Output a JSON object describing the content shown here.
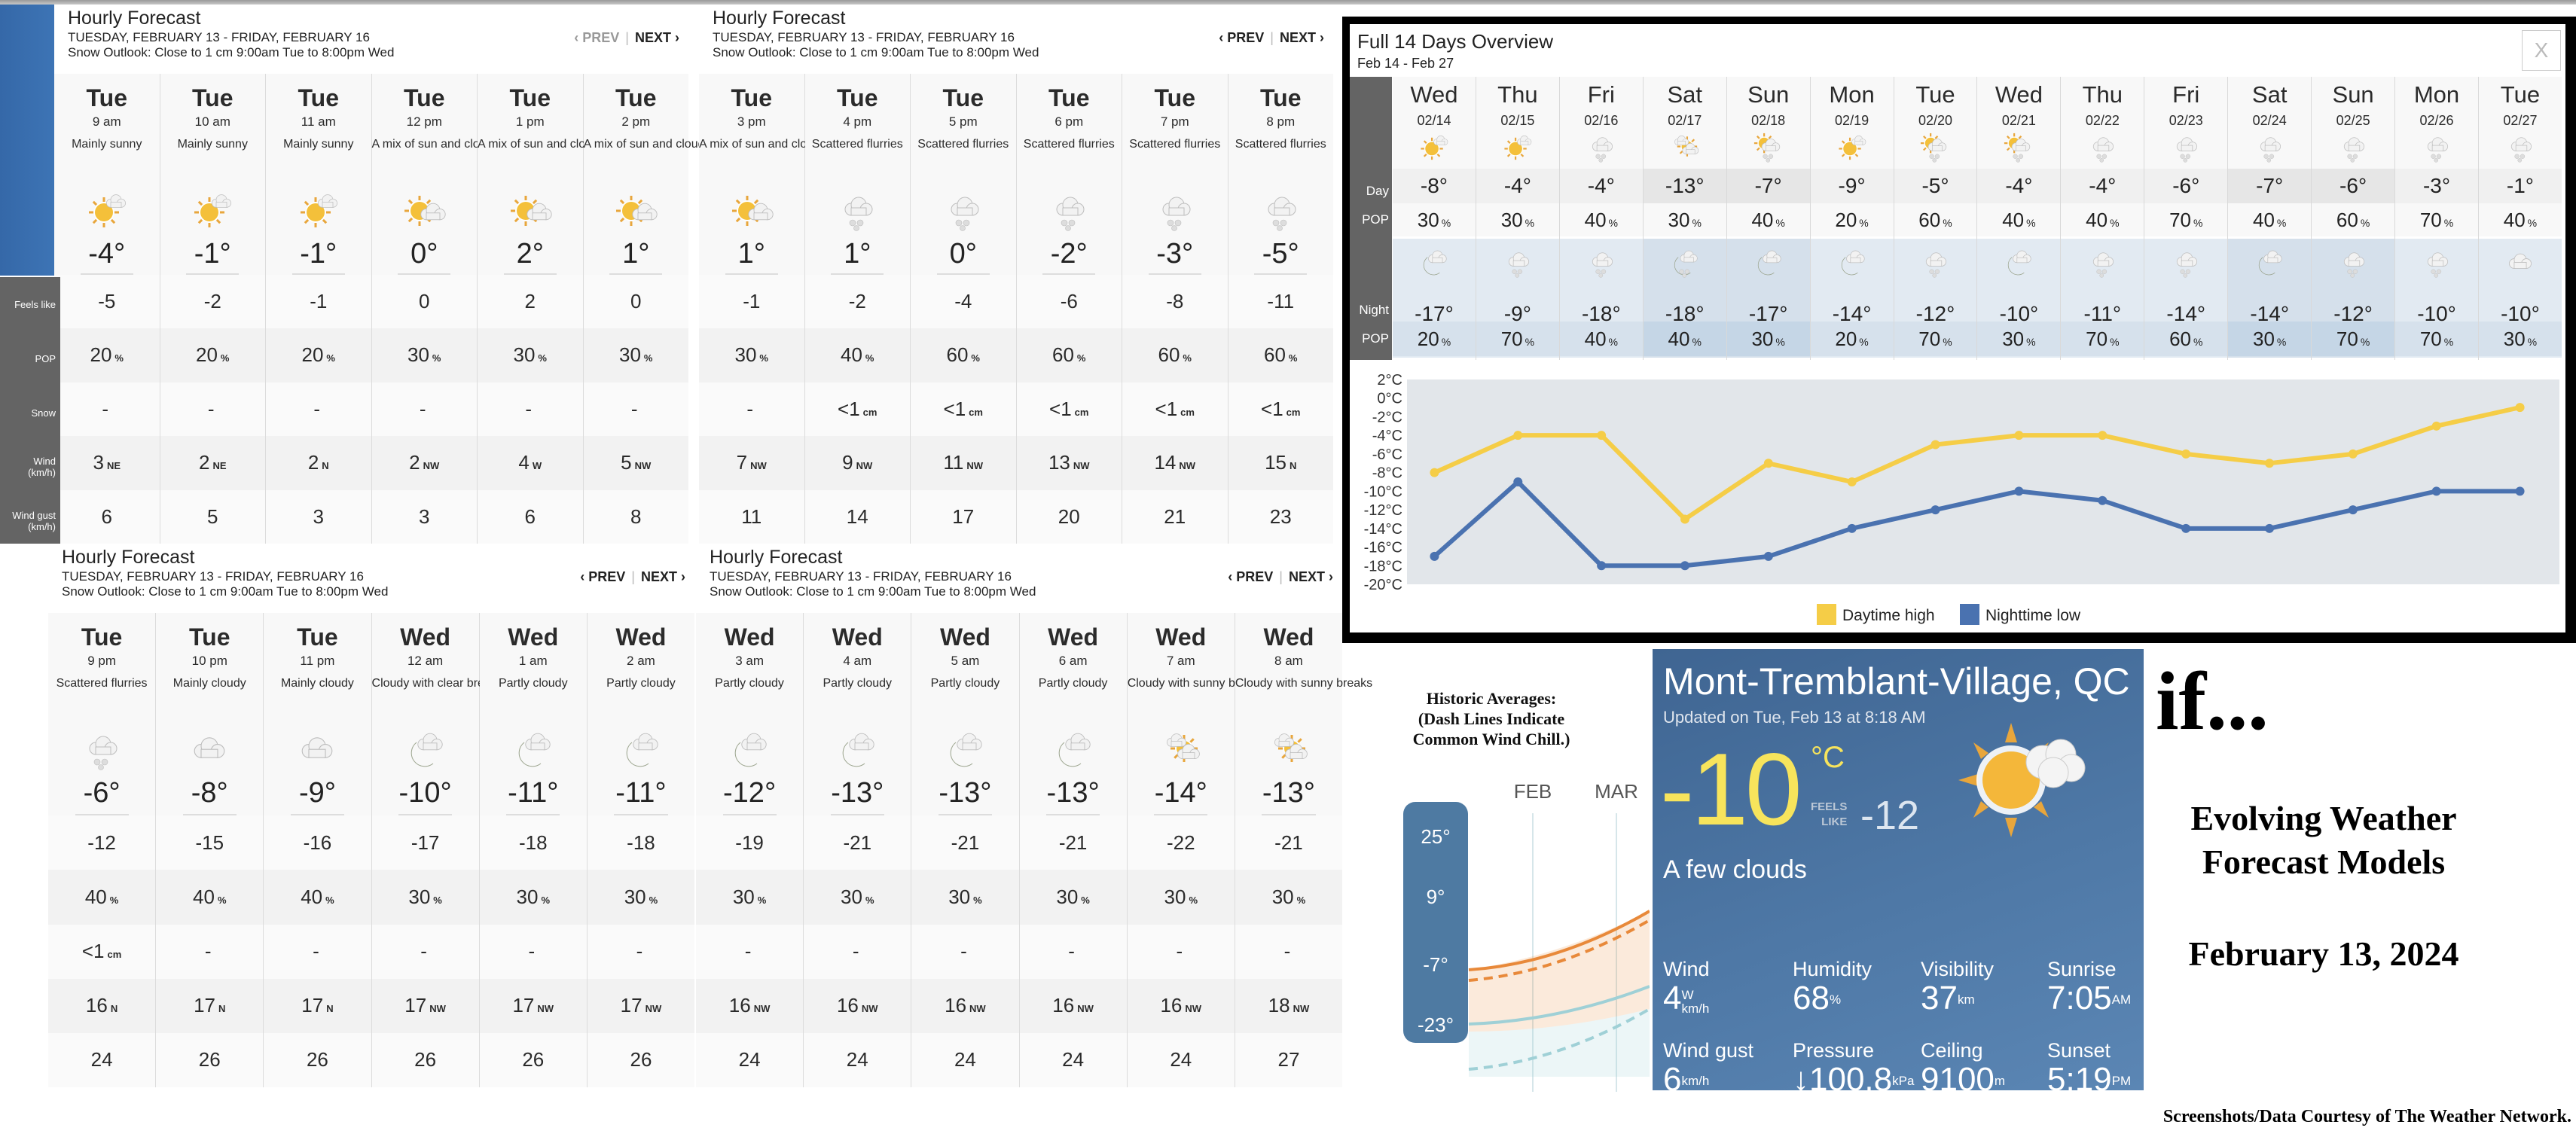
{
  "hourly_header": {
    "title": "Hourly Forecast",
    "date_range": "TUESDAY, FEBRUARY 13 - FRIDAY, FEBRUARY 16",
    "snow_outlook": "Snow Outlook: Close to 1 cm 9:00am Tue to 8:00pm Wed",
    "prev_label": "‹ PREV",
    "next_label": "NEXT ›",
    "separator": "|"
  },
  "row_labels": [
    "Feels like",
    "POP",
    "Snow",
    "Wind\n(km/h)",
    "Wind gust\n(km/h)"
  ],
  "hourly_panels": [
    {
      "hours": [
        {
          "day": "Tue",
          "time": "9 am",
          "cond": "Mainly sunny",
          "icon": "sun-cloud-icon",
          "temp": "-4°",
          "feels": "-5",
          "pop": "20",
          "snow": "-",
          "snow_unit": "",
          "wind": "3",
          "dir": "NE",
          "gust": "6"
        },
        {
          "day": "Tue",
          "time": "10 am",
          "cond": "Mainly sunny",
          "icon": "sun-cloud-icon",
          "temp": "-1°",
          "feels": "-2",
          "pop": "20",
          "snow": "-",
          "snow_unit": "",
          "wind": "2",
          "dir": "NE",
          "gust": "5"
        },
        {
          "day": "Tue",
          "time": "11 am",
          "cond": "Mainly sunny",
          "icon": "sun-cloud-icon",
          "temp": "-1°",
          "feels": "-1",
          "pop": "20",
          "snow": "-",
          "snow_unit": "",
          "wind": "2",
          "dir": "N",
          "gust": "3"
        },
        {
          "day": "Tue",
          "time": "12 pm",
          "cond": "A mix of sun and clouds",
          "icon": "sun-clouds-icon",
          "temp": "0°",
          "feels": "0",
          "pop": "30",
          "snow": "-",
          "snow_unit": "",
          "wind": "2",
          "dir": "NW",
          "gust": "3"
        },
        {
          "day": "Tue",
          "time": "1 pm",
          "cond": "A mix of sun and clouds",
          "icon": "sun-clouds-icon",
          "temp": "2°",
          "feels": "2",
          "pop": "30",
          "snow": "-",
          "snow_unit": "",
          "wind": "4",
          "dir": "W",
          "gust": "6"
        },
        {
          "day": "Tue",
          "time": "2 pm",
          "cond": "A mix of sun and clouds",
          "icon": "sun-clouds-icon",
          "temp": "1°",
          "feels": "0",
          "pop": "30",
          "snow": "-",
          "snow_unit": "",
          "wind": "5",
          "dir": "NW",
          "gust": "8"
        }
      ],
      "prev_dim": true
    },
    {
      "hours": [
        {
          "day": "Tue",
          "time": "3 pm",
          "cond": "A mix of sun and clouds",
          "icon": "sun-clouds-icon",
          "temp": "1°",
          "feels": "-1",
          "pop": "30",
          "snow": "-",
          "snow_unit": "",
          "wind": "7",
          "dir": "NW",
          "gust": "11"
        },
        {
          "day": "Tue",
          "time": "4 pm",
          "cond": "Scattered flurries",
          "icon": "flurries-icon",
          "temp": "1°",
          "feels": "-2",
          "pop": "40",
          "snow": "<1",
          "snow_unit": "cm",
          "wind": "9",
          "dir": "NW",
          "gust": "14"
        },
        {
          "day": "Tue",
          "time": "5 pm",
          "cond": "Scattered flurries",
          "icon": "flurries-icon",
          "temp": "0°",
          "feels": "-4",
          "pop": "60",
          "snow": "<1",
          "snow_unit": "cm",
          "wind": "11",
          "dir": "NW",
          "gust": "17"
        },
        {
          "day": "Tue",
          "time": "6 pm",
          "cond": "Scattered flurries",
          "icon": "flurries-icon",
          "temp": "-2°",
          "feels": "-6",
          "pop": "60",
          "snow": "<1",
          "snow_unit": "cm",
          "wind": "13",
          "dir": "NW",
          "gust": "20"
        },
        {
          "day": "Tue",
          "time": "7 pm",
          "cond": "Scattered flurries",
          "icon": "flurries-icon",
          "temp": "-3°",
          "feels": "-8",
          "pop": "60",
          "snow": "<1",
          "snow_unit": "cm",
          "wind": "14",
          "dir": "NW",
          "gust": "21"
        },
        {
          "day": "Tue",
          "time": "8 pm",
          "cond": "Scattered flurries",
          "icon": "flurries-icon",
          "temp": "-5°",
          "feels": "-11",
          "pop": "60",
          "snow": "<1",
          "snow_unit": "cm",
          "wind": "15",
          "dir": "N",
          "gust": "23"
        }
      ],
      "prev_dim": false
    },
    {
      "hours": [
        {
          "day": "Tue",
          "time": "9 pm",
          "cond": "Scattered flurries",
          "icon": "flurries-icon",
          "temp": "-6°",
          "feels": "-12",
          "pop": "40",
          "snow": "<1",
          "snow_unit": "cm",
          "wind": "16",
          "dir": "N",
          "gust": "24"
        },
        {
          "day": "Tue",
          "time": "10 pm",
          "cond": "Mainly cloudy",
          "icon": "cloud-icon",
          "temp": "-8°",
          "feels": "-15",
          "pop": "40",
          "snow": "-",
          "snow_unit": "",
          "wind": "17",
          "dir": "N",
          "gust": "26"
        },
        {
          "day": "Tue",
          "time": "11 pm",
          "cond": "Mainly cloudy",
          "icon": "cloud-icon",
          "temp": "-9°",
          "feels": "-16",
          "pop": "40",
          "snow": "-",
          "snow_unit": "",
          "wind": "17",
          "dir": "N",
          "gust": "26"
        },
        {
          "day": "Wed",
          "time": "12 am",
          "cond": "Cloudy with clear breaks",
          "icon": "moon-cloud-icon",
          "temp": "-10°",
          "feels": "-17",
          "pop": "30",
          "snow": "-",
          "snow_unit": "",
          "wind": "17",
          "dir": "NW",
          "gust": "26"
        },
        {
          "day": "Wed",
          "time": "1 am",
          "cond": "Partly cloudy",
          "icon": "moon-cloud-icon",
          "temp": "-11°",
          "feels": "-18",
          "pop": "30",
          "snow": "-",
          "snow_unit": "",
          "wind": "17",
          "dir": "NW",
          "gust": "26"
        },
        {
          "day": "Wed",
          "time": "2 am",
          "cond": "Partly cloudy",
          "icon": "moon-cloud-icon",
          "temp": "-11°",
          "feels": "-18",
          "pop": "30",
          "snow": "-",
          "snow_unit": "",
          "wind": "17",
          "dir": "NW",
          "gust": "26"
        }
      ],
      "prev_dim": false
    },
    {
      "hours": [
        {
          "day": "Wed",
          "time": "3 am",
          "cond": "Partly cloudy",
          "icon": "moon-cloud-icon",
          "temp": "-12°",
          "feels": "-19",
          "pop": "30",
          "snow": "-",
          "snow_unit": "",
          "wind": "16",
          "dir": "NW",
          "gust": "24"
        },
        {
          "day": "Wed",
          "time": "4 am",
          "cond": "Partly cloudy",
          "icon": "moon-cloud-icon",
          "temp": "-13°",
          "feels": "-21",
          "pop": "30",
          "snow": "-",
          "snow_unit": "",
          "wind": "16",
          "dir": "NW",
          "gust": "24"
        },
        {
          "day": "Wed",
          "time": "5 am",
          "cond": "Partly cloudy",
          "icon": "moon-cloud-icon",
          "temp": "-13°",
          "feels": "-21",
          "pop": "30",
          "snow": "-",
          "snow_unit": "",
          "wind": "16",
          "dir": "NW",
          "gust": "24"
        },
        {
          "day": "Wed",
          "time": "6 am",
          "cond": "Partly cloudy",
          "icon": "moon-cloud-icon",
          "temp": "-13°",
          "feels": "-21",
          "pop": "30",
          "snow": "-",
          "snow_unit": "",
          "wind": "16",
          "dir": "NW",
          "gust": "24"
        },
        {
          "day": "Wed",
          "time": "7 am",
          "cond": "Cloudy with sunny breaks",
          "icon": "cloud-sun-icon",
          "temp": "-14°",
          "feels": "-22",
          "pop": "30",
          "snow": "-",
          "snow_unit": "",
          "wind": "16",
          "dir": "NW",
          "gust": "24"
        },
        {
          "day": "Wed",
          "time": "8 am",
          "cond": "Cloudy with sunny breaks",
          "icon": "cloud-sun-icon",
          "temp": "-13°",
          "feels": "-21",
          "pop": "30",
          "snow": "-",
          "snow_unit": "",
          "wind": "18",
          "dir": "NW",
          "gust": "27"
        }
      ],
      "prev_dim": false
    }
  ],
  "units": {
    "percent": "%",
    "cm": "cm"
  },
  "overview": {
    "title": "Full 14 Days Overview",
    "range": "Feb 14 - Feb 27",
    "close_label": "X",
    "labels": {
      "day": "Day",
      "pop": "POP",
      "night": "Night"
    },
    "days": [
      {
        "name": "Wed",
        "date": "02/14",
        "day_icon": "sun-cloud-icon",
        "hi": "-8°",
        "pop_day": "30",
        "night_icon": "moon-cloud-icon",
        "lo": "-17°",
        "pop_night": "20",
        "weekend": false
      },
      {
        "name": "Thu",
        "date": "02/15",
        "day_icon": "sun-cloud-icon",
        "hi": "-4°",
        "pop_day": "30",
        "night_icon": "flurries-icon",
        "lo": "-9°",
        "pop_night": "70",
        "weekend": false
      },
      {
        "name": "Fri",
        "date": "02/16",
        "day_icon": "flurries-icon",
        "hi": "-4°",
        "pop_day": "40",
        "night_icon": "flurries-icon",
        "lo": "-18°",
        "pop_night": "40",
        "weekend": false
      },
      {
        "name": "Sat",
        "date": "02/17",
        "day_icon": "cloud-sun-icon",
        "hi": "-13°",
        "pop_day": "30",
        "night_icon": "moon-flurries-icon",
        "lo": "-18°",
        "pop_night": "40",
        "weekend": true
      },
      {
        "name": "Sun",
        "date": "02/18",
        "day_icon": "sun-flurries-icon",
        "hi": "-7°",
        "pop_day": "40",
        "night_icon": "moon-cloud-icon",
        "lo": "-17°",
        "pop_night": "30",
        "weekend": true
      },
      {
        "name": "Mon",
        "date": "02/19",
        "day_icon": "sun-cloud-icon",
        "hi": "-9°",
        "pop_day": "20",
        "night_icon": "moon-cloud-icon",
        "lo": "-14°",
        "pop_night": "20",
        "weekend": false
      },
      {
        "name": "Tue",
        "date": "02/20",
        "day_icon": "sun-flurries-icon",
        "hi": "-5°",
        "pop_day": "60",
        "night_icon": "flurries-icon",
        "lo": "-12°",
        "pop_night": "70",
        "weekend": false
      },
      {
        "name": "Wed",
        "date": "02/21",
        "day_icon": "sun-flurries-icon",
        "hi": "-4°",
        "pop_day": "40",
        "night_icon": "moon-cloud-icon",
        "lo": "-10°",
        "pop_night": "30",
        "weekend": false
      },
      {
        "name": "Thu",
        "date": "02/22",
        "day_icon": "flurries-icon",
        "hi": "-4°",
        "pop_day": "40",
        "night_icon": "flurries-icon",
        "lo": "-11°",
        "pop_night": "70",
        "weekend": false
      },
      {
        "name": "Fri",
        "date": "02/23",
        "day_icon": "flurries-icon",
        "hi": "-6°",
        "pop_day": "70",
        "night_icon": "flurries-icon",
        "lo": "-14°",
        "pop_night": "60",
        "weekend": false
      },
      {
        "name": "Sat",
        "date": "02/24",
        "day_icon": "flurries-icon",
        "hi": "-7°",
        "pop_day": "40",
        "night_icon": "moon-cloud-icon",
        "lo": "-14°",
        "pop_night": "30",
        "weekend": true
      },
      {
        "name": "Sun",
        "date": "02/25",
        "day_icon": "flurries-icon",
        "hi": "-6°",
        "pop_day": "60",
        "night_icon": "flurries-icon",
        "lo": "-12°",
        "pop_night": "70",
        "weekend": true
      },
      {
        "name": "Mon",
        "date": "02/26",
        "day_icon": "flurries-icon",
        "hi": "-3°",
        "pop_day": "70",
        "night_icon": "flurries-icon",
        "lo": "-10°",
        "pop_night": "70",
        "weekend": false
      },
      {
        "name": "Tue",
        "date": "02/27",
        "day_icon": "flurries-icon",
        "hi": "-1°",
        "pop_day": "40",
        "night_icon": "cloud-icon",
        "lo": "-10°",
        "pop_night": "30",
        "weekend": false
      }
    ]
  },
  "chart_data": {
    "type": "line",
    "title": "",
    "xlabel": "",
    "ylabel": "",
    "x": [
      "02/14",
      "02/15",
      "02/16",
      "02/17",
      "02/18",
      "02/19",
      "02/20",
      "02/21",
      "02/22",
      "02/23",
      "02/24",
      "02/25",
      "02/26",
      "02/27"
    ],
    "series": [
      {
        "name": "Daytime high",
        "color": "#f5cd47",
        "values": [
          -8,
          -4,
          -4,
          -13,
          -7,
          -9,
          -5,
          -4,
          -4,
          -6,
          -7,
          -6,
          -3,
          -1
        ]
      },
      {
        "name": "Nighttime low",
        "color": "#4a72b0",
        "values": [
          -17,
          -9,
          -18,
          -18,
          -17,
          -14,
          -12,
          -10,
          -11,
          -14,
          -14,
          -12,
          -10,
          -10
        ]
      }
    ],
    "yticks": [
      2,
      0,
      -2,
      -4,
      -6,
      -8,
      -10,
      -12,
      -14,
      -16,
      -18,
      -20
    ],
    "ytick_suffix": "°C",
    "ylim": [
      -20,
      2
    ],
    "grid": false,
    "legend": "bottom-center",
    "plot_bg": "#e2e6ea"
  },
  "historic": {
    "title": "Historic Averages:\n(Dash Lines Indicate\nCommon Wind Chill.)",
    "months": [
      "FEB",
      "MAR"
    ],
    "scale": [
      "25°",
      "9°",
      "-7°",
      "-23°"
    ],
    "high_color": "#e8893a",
    "low_color": "#9fd0d6"
  },
  "current": {
    "city": "Mont-Tremblant-Village, QC",
    "updated": "Updated on Tue, Feb 13 at 8:18 AM",
    "temp": "-10",
    "unit": "°C",
    "feels_label_1": "FEELS",
    "feels_label_2": "LIKE",
    "feels": "-12",
    "condition": "A few clouds",
    "icon": "sun-cloud-icon",
    "stats": [
      {
        "label": "Wind",
        "value": "4",
        "sup": "W",
        "sub": "km/h"
      },
      {
        "label": "Humidity",
        "value": "68",
        "sup": "%"
      },
      {
        "label": "Visibility",
        "value": "37",
        "sup": "km"
      },
      {
        "label": "Sunrise",
        "value": "7:05",
        "sup": "AM"
      },
      {
        "label": "Wind gust",
        "value": "6",
        "sup": "km/h"
      },
      {
        "label": "Pressure",
        "value": "↓100.8",
        "sup": "kPa"
      },
      {
        "label": "Ceiling",
        "value": "9100",
        "sup": "m"
      },
      {
        "label": "Sunset",
        "value": "5:19",
        "sup": "PM"
      }
    ]
  },
  "headline": {
    "if": "if...",
    "subtitle": "Evolving Weather\nForecast Models",
    "date": "February 13, 2024",
    "credit": "Screenshots/Data Courtesy of The Weather Network."
  }
}
